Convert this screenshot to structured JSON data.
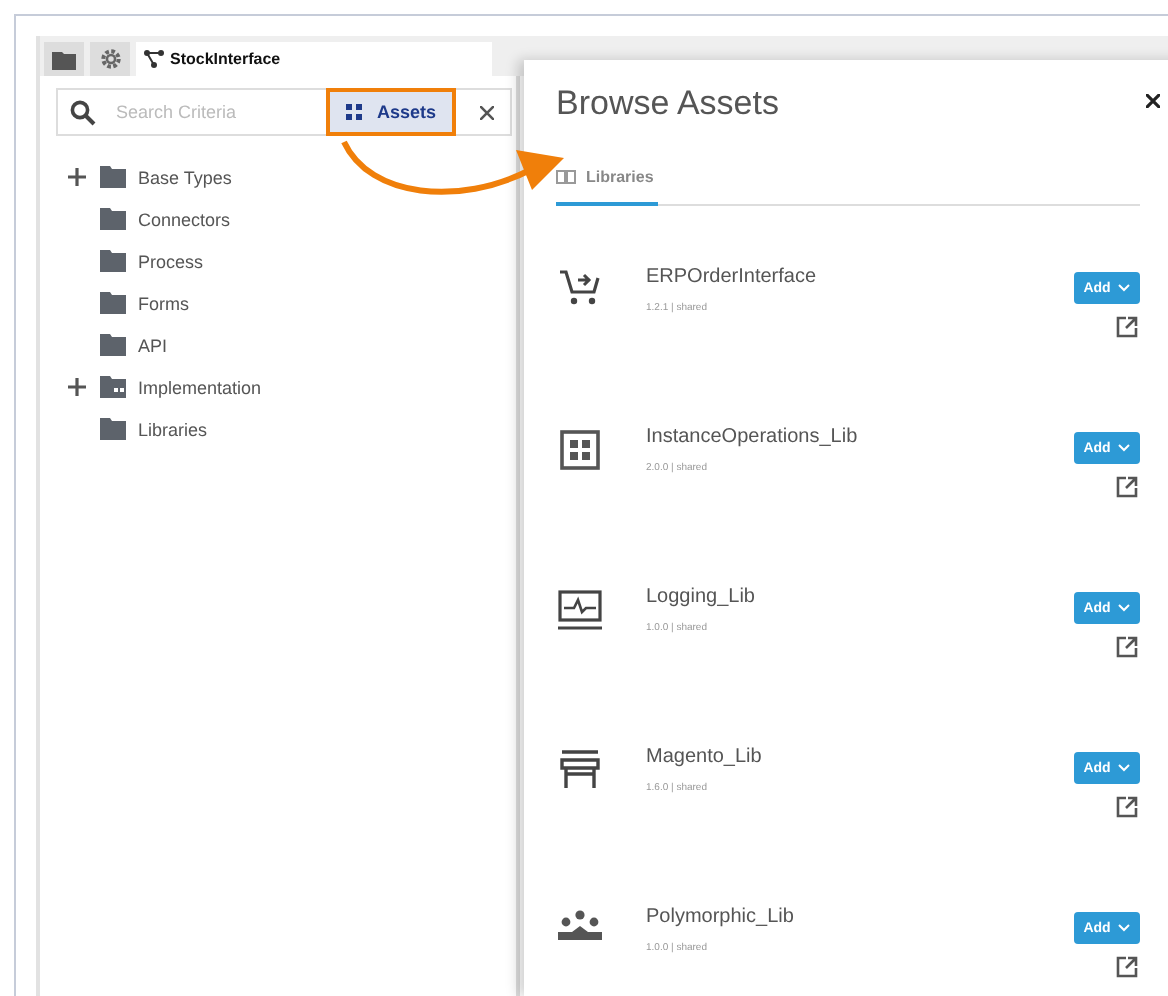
{
  "tabs": [
    {
      "kind": "folder",
      "selected": false
    },
    {
      "kind": "gear",
      "selected": false
    },
    {
      "kind": "diagram",
      "label": "StockInterface",
      "selected": true
    }
  ],
  "search": {
    "placeholder": "Search Criteria"
  },
  "assets_button": {
    "label": "Assets"
  },
  "tree": [
    {
      "label": "Base Types",
      "kind": "folder",
      "expandable": true
    },
    {
      "label": "Connectors",
      "kind": "folder",
      "expandable": false
    },
    {
      "label": "Process",
      "kind": "folder",
      "expandable": false
    },
    {
      "label": "Forms",
      "kind": "folder",
      "expandable": false
    },
    {
      "label": "API",
      "kind": "folder",
      "expandable": false
    },
    {
      "label": "Implementation",
      "kind": "package-folder",
      "expandable": true
    },
    {
      "label": "Libraries",
      "kind": "folder",
      "expandable": false
    }
  ],
  "drawer": {
    "title": "Browse Assets",
    "tabs": [
      {
        "label": "Libraries",
        "selected": true
      }
    ],
    "libraries": [
      {
        "name": "ERPOrderInterface",
        "version": "1.2.1 | shared",
        "kind": "cart",
        "button": "Add"
      },
      {
        "name": "InstanceOperations_Lib",
        "version": "2.0.0 | shared",
        "kind": "grid",
        "button": "Add"
      },
      {
        "name": "Logging_Lib",
        "version": "1.0.0 | shared",
        "kind": "monitor",
        "button": "Add"
      },
      {
        "name": "Magento_Lib",
        "version": "1.6.0 | shared",
        "kind": "store",
        "button": "Add"
      },
      {
        "name": "Polymorphic_Lib",
        "version": "1.0.0 | shared",
        "kind": "people",
        "button": "Add"
      }
    ]
  }
}
